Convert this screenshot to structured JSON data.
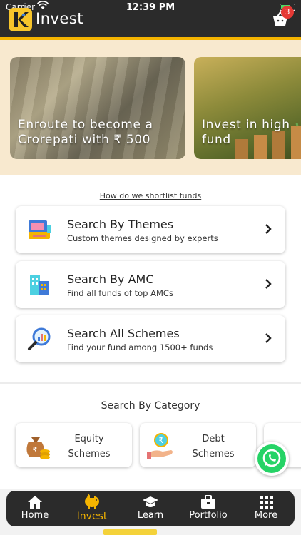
{
  "status_bar": {
    "carrier": "Carrier",
    "time": "12:39 PM"
  },
  "header": {
    "title": "Invest",
    "cart_badge": "3"
  },
  "banners": [
    {
      "text": "Enroute to become a Crorepati with ₹ 500"
    },
    {
      "text": "Invest in high fund"
    }
  ],
  "shortlist_link": "How do we shortlist funds",
  "search_cards": [
    {
      "title": "Search By Themes",
      "subtitle": "Custom themes designed by experts",
      "icon": "themes-icon"
    },
    {
      "title": "Search By AMC",
      "subtitle": "Find all funds of top AMCs",
      "icon": "amc-building-icon"
    },
    {
      "title": "Search All Schemes",
      "subtitle": "Find your fund among 1500+ funds",
      "icon": "magnifier-chart-icon"
    }
  ],
  "category": {
    "heading": "Search By Category",
    "items": [
      {
        "label": "Equity Schemes",
        "icon": "money-bag-icon"
      },
      {
        "label": "Debt Schemes",
        "icon": "rupee-hand-icon"
      }
    ]
  },
  "nav": {
    "items": [
      {
        "label": "Home",
        "icon": "home-icon"
      },
      {
        "label": "Invest",
        "icon": "piggy-bank-icon",
        "active": true
      },
      {
        "label": "Learn",
        "icon": "graduation-cap-icon"
      },
      {
        "label": "Portfolio",
        "icon": "briefcase-icon"
      },
      {
        "label": "More",
        "icon": "grid-icon"
      }
    ]
  },
  "colors": {
    "accent": "#f4b400",
    "dark": "#2b2b2b",
    "whatsapp": "#25d366"
  }
}
